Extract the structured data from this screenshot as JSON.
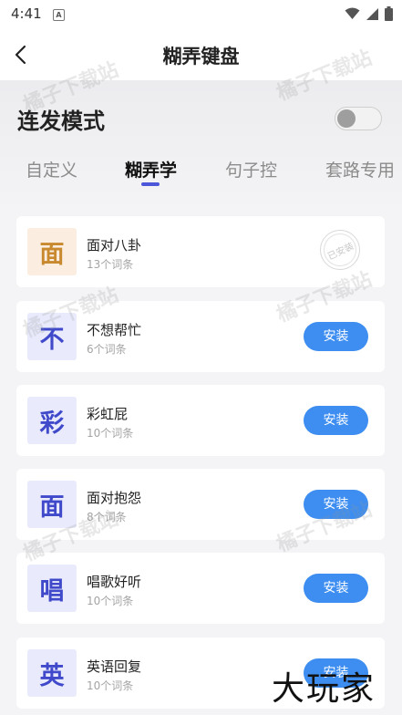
{
  "status_bar": {
    "time": "4:41",
    "notification_letter": "A"
  },
  "header": {
    "title": "糊弄键盘"
  },
  "mode": {
    "label": "连发模式",
    "enabled": false
  },
  "tabs": [
    {
      "label": "自定义",
      "active": false
    },
    {
      "label": "糊弄学",
      "active": true
    },
    {
      "label": "句子控",
      "active": false
    },
    {
      "label": "套路专用",
      "active": false
    }
  ],
  "cards": [
    {
      "icon_char": "面",
      "icon_style": "orange",
      "title": "面对八卦",
      "subtitle": "13个词条",
      "status": "installed",
      "stamp_text": "已安装"
    },
    {
      "icon_char": "不",
      "icon_style": "blue",
      "title": "不想帮忙",
      "subtitle": "6个词条",
      "status": "available",
      "button_label": "安装"
    },
    {
      "icon_char": "彩",
      "icon_style": "blue",
      "title": "彩虹屁",
      "subtitle": "10个词条",
      "status": "available",
      "button_label": "安装"
    },
    {
      "icon_char": "面",
      "icon_style": "blue",
      "title": "面对抱怨",
      "subtitle": "8个词条",
      "status": "available",
      "button_label": "安装"
    },
    {
      "icon_char": "唱",
      "icon_style": "blue",
      "title": "唱歌好听",
      "subtitle": "10个词条",
      "status": "available",
      "button_label": "安装"
    },
    {
      "icon_char": "英",
      "icon_style": "blue",
      "title": "英语回复",
      "subtitle": "10个词条",
      "status": "available",
      "button_label": "安装"
    }
  ],
  "watermark_text": "橘子下载站",
  "corner_logo_text": "大玩家",
  "colors": {
    "accent": "#3d8ef0",
    "tab_indicator": "#4b56d8"
  }
}
